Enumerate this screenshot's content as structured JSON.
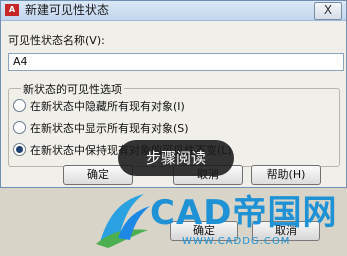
{
  "dialog": {
    "title": "新建可见性状态",
    "app_icon_text": "A",
    "close_label": "X",
    "name_label": "可见性状态名称(V):",
    "name_value": "A4",
    "group": {
      "legend": "新状态的可见性选项",
      "options": [
        "在新状态中隐藏所有现有对象(I)",
        "在新状态中显示所有现有对象(S)",
        "在新状态中保持现有对象的可见性不变(L)"
      ],
      "selected_index": 2
    },
    "buttons": {
      "ok": "确定",
      "cancel": "取消",
      "help": "帮助(H)"
    }
  },
  "background_buttons": {
    "ok": "确定",
    "cancel": "取消"
  },
  "overlay": {
    "tooltip": "步骤阅读"
  },
  "watermark": {
    "brand": "CAD帝国网",
    "url": "WWW.CADDG.COM",
    "color": "#1f92d6"
  }
}
